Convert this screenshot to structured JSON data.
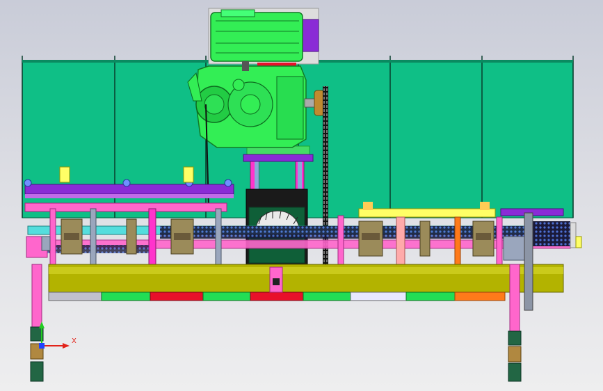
{
  "viewport": {
    "background_top": "#c9ccd8",
    "background_bottom": "#eeeeef"
  },
  "colors": {
    "engine_green": "#33ee55",
    "engine_dark": "#17a62e",
    "panel_teal": "#0fbf86",
    "frame_purple": "#8a2bd6",
    "magenta": "#ff33cc",
    "pink": "#ff66cc",
    "cyan": "#55dddd",
    "olive": "#b3b300",
    "yellow": "#ffff66",
    "red": "#e8102a",
    "orange": "#ff7a1a",
    "gray_steel": "#8c95a6",
    "dark_brown": "#6a5a3a",
    "black_chain": "#222222",
    "axis_x": "#e2231a",
    "axis_y": "#22cc22",
    "axis_z": "#2244ff"
  },
  "axis_triad": {
    "x_label": "X"
  }
}
